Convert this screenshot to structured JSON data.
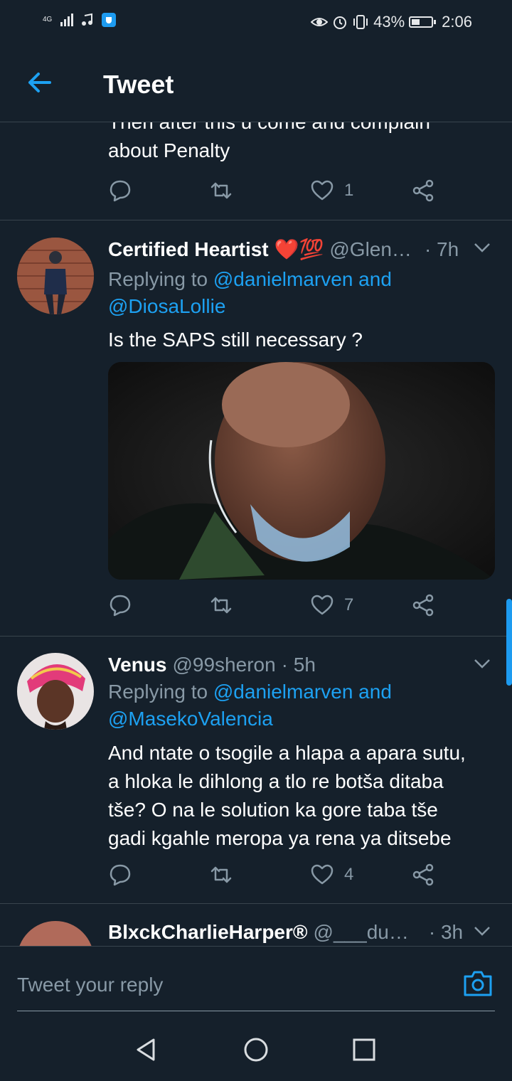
{
  "status_bar": {
    "network": "4G",
    "battery_percent": "43%",
    "battery_level": 0.43,
    "time": "2:06"
  },
  "header": {
    "title": "Tweet"
  },
  "tweets": [
    {
      "text_lines": [
        "Then after this u come and complain",
        "about Penalty"
      ],
      "reply_count": "",
      "retweet_count": "",
      "like_count": "1"
    },
    {
      "name": "Certified Heartist",
      "emoji": "❤️💯",
      "handle": "@Glen…",
      "time": "· 7h",
      "replying_prefix": "Replying to",
      "replying_to": "@danielmarven and",
      "replying_to2": "@DiosaLollie",
      "text": "Is the SAPS still necessary ?",
      "like_count": "7"
    },
    {
      "name": "Venus",
      "handle": "@99sheron",
      "time": "· 5h",
      "replying_prefix": "Replying to",
      "replying_to": "@danielmarven and",
      "replying_to2": "@MasekoValencia",
      "text_lines": [
        "And ntate o tsogile a hlapa a apara sutu,",
        "a hloka le dihlong a tlo re botša ditaba",
        "tše? O na le solution ka gore taba tše",
        "gadi kgahle meropa ya rena ya ditsebe"
      ],
      "like_count": "4"
    },
    {
      "name": "BlxckCharlieHarper®",
      "handle": "@___du…",
      "time": "· 3h"
    }
  ],
  "reply_bar": {
    "placeholder": "Tweet your reply"
  },
  "icons": {
    "back": "arrow-left-icon",
    "reply": "speech-bubble-icon",
    "retweet": "retweet-arrows-icon",
    "like": "heart-icon",
    "share": "share-nodes-icon",
    "camera": "camera-icon",
    "nav_back": "triangle-back-icon",
    "nav_home": "circle-home-icon",
    "nav_recents": "square-recents-icon"
  },
  "colors": {
    "background": "#15202b",
    "accent": "#1da1f2",
    "secondary_text": "#8899a6",
    "divider": "#38444d"
  }
}
